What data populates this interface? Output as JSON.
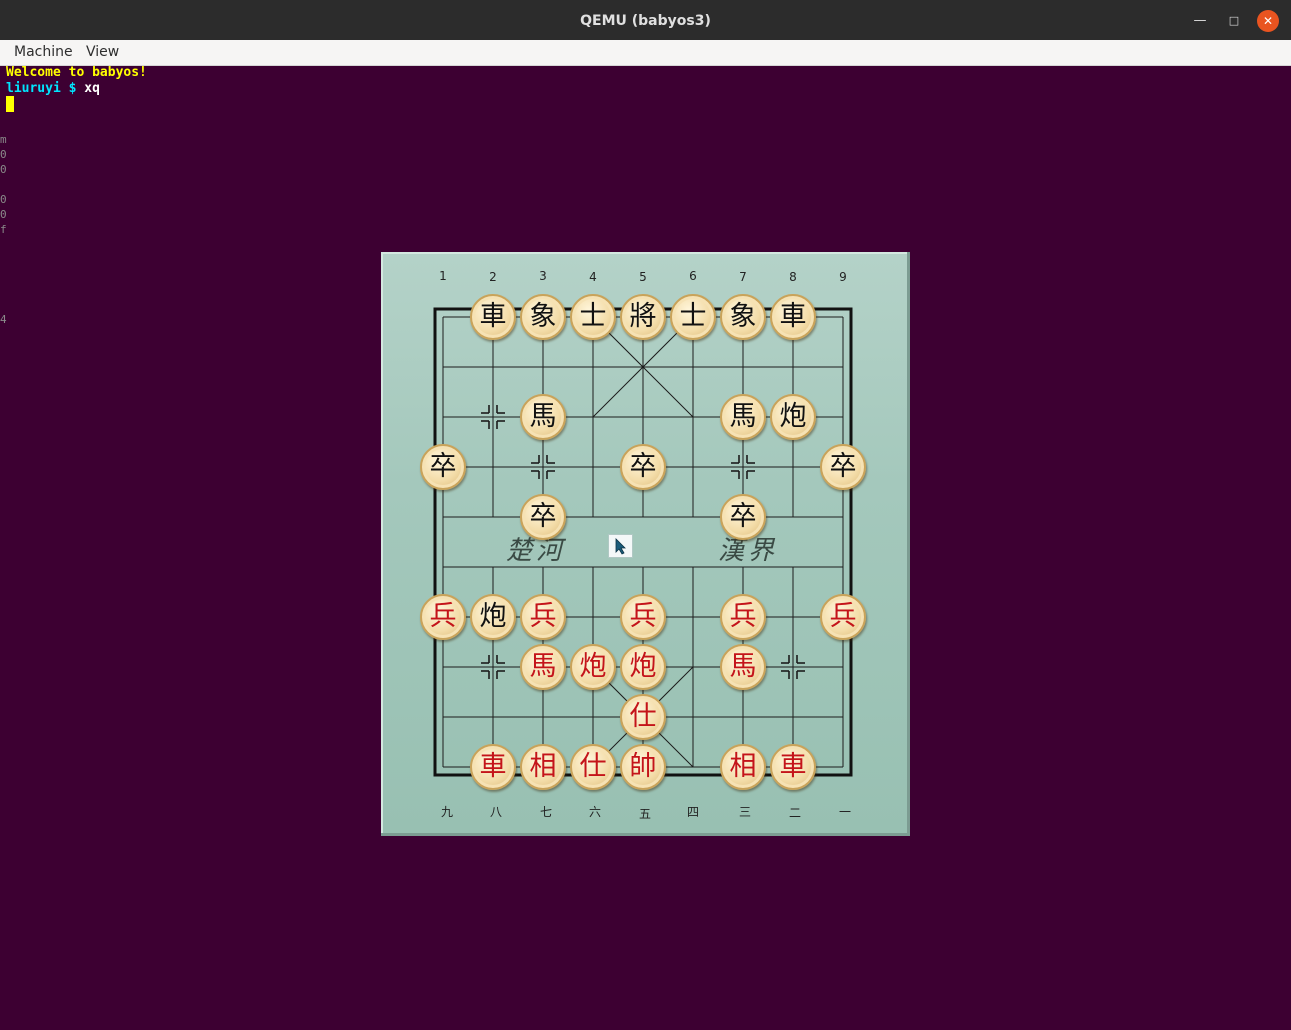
{
  "window": {
    "title": "QEMU (babyos3)",
    "minimize_icon": "minimize-icon",
    "maximize_icon": "maximize-icon",
    "close_icon": "close-icon"
  },
  "menu": {
    "items": [
      {
        "label": "Machine"
      },
      {
        "label": "View"
      }
    ]
  },
  "terminal": {
    "welcome": "Welcome to babyos!",
    "prompt_user": "liuruyi",
    "prompt_symbol": "$",
    "command": "xq",
    "colors": {
      "welcome": "#ffff00",
      "user": "#00e5ff",
      "command": "#ffffff"
    },
    "edge_glyphs": [
      "m",
      "0",
      "0",
      "0",
      "0",
      "f",
      "4"
    ]
  },
  "game": {
    "top_numbers": [
      "1",
      "2",
      "3",
      "4",
      "5",
      "6",
      "7",
      "8",
      "9"
    ],
    "bottom_numbers": [
      "九",
      "八",
      "七",
      "六",
      "五",
      "四",
      "三",
      "二",
      "一"
    ],
    "river_left": "楚河",
    "river_right": "漢界",
    "pieces": [
      {
        "side": "black",
        "char": "車",
        "col": 1,
        "row": 0
      },
      {
        "side": "black",
        "char": "象",
        "col": 2,
        "row": 0
      },
      {
        "side": "black",
        "char": "士",
        "col": 3,
        "row": 0
      },
      {
        "side": "black",
        "char": "將",
        "col": 4,
        "row": 0
      },
      {
        "side": "black",
        "char": "士",
        "col": 5,
        "row": 0
      },
      {
        "side": "black",
        "char": "象",
        "col": 6,
        "row": 0
      },
      {
        "side": "black",
        "char": "車",
        "col": 7,
        "row": 0
      },
      {
        "side": "black",
        "char": "馬",
        "col": 2,
        "row": 2
      },
      {
        "side": "black",
        "char": "馬",
        "col": 6,
        "row": 2
      },
      {
        "side": "black",
        "char": "炮",
        "col": 7,
        "row": 2
      },
      {
        "side": "black",
        "char": "卒",
        "col": 0,
        "row": 3
      },
      {
        "side": "black",
        "char": "卒",
        "col": 4,
        "row": 3
      },
      {
        "side": "black",
        "char": "卒",
        "col": 8,
        "row": 3
      },
      {
        "side": "black",
        "char": "卒",
        "col": 2,
        "row": 4
      },
      {
        "side": "black",
        "char": "卒",
        "col": 6,
        "row": 4
      },
      {
        "side": "black",
        "char": "炮",
        "col": 1,
        "row": 6
      },
      {
        "side": "red",
        "char": "兵",
        "col": 0,
        "row": 6
      },
      {
        "side": "red",
        "char": "兵",
        "col": 2,
        "row": 6
      },
      {
        "side": "red",
        "char": "兵",
        "col": 4,
        "row": 6
      },
      {
        "side": "red",
        "char": "兵",
        "col": 6,
        "row": 6
      },
      {
        "side": "red",
        "char": "兵",
        "col": 8,
        "row": 6
      },
      {
        "side": "red",
        "char": "馬",
        "col": 2,
        "row": 7
      },
      {
        "side": "red",
        "char": "炮",
        "col": 3,
        "row": 7
      },
      {
        "side": "red",
        "char": "炮",
        "col": 4,
        "row": 7
      },
      {
        "side": "red",
        "char": "馬",
        "col": 6,
        "row": 7
      },
      {
        "side": "red",
        "char": "仕",
        "col": 4,
        "row": 8
      },
      {
        "side": "red",
        "char": "車",
        "col": 1,
        "row": 9
      },
      {
        "side": "red",
        "char": "相",
        "col": 2,
        "row": 9
      },
      {
        "side": "red",
        "char": "仕",
        "col": 3,
        "row": 9
      },
      {
        "side": "red",
        "char": "帥",
        "col": 4,
        "row": 9
      },
      {
        "side": "red",
        "char": "相",
        "col": 6,
        "row": 9
      },
      {
        "side": "red",
        "char": "車",
        "col": 7,
        "row": 9
      }
    ],
    "position_markers": [
      {
        "col": 1,
        "row": 2
      },
      {
        "col": 2,
        "row": 3
      },
      {
        "col": 6,
        "row": 3
      },
      {
        "col": 1,
        "row": 7
      },
      {
        "col": 7,
        "row": 7
      }
    ]
  }
}
